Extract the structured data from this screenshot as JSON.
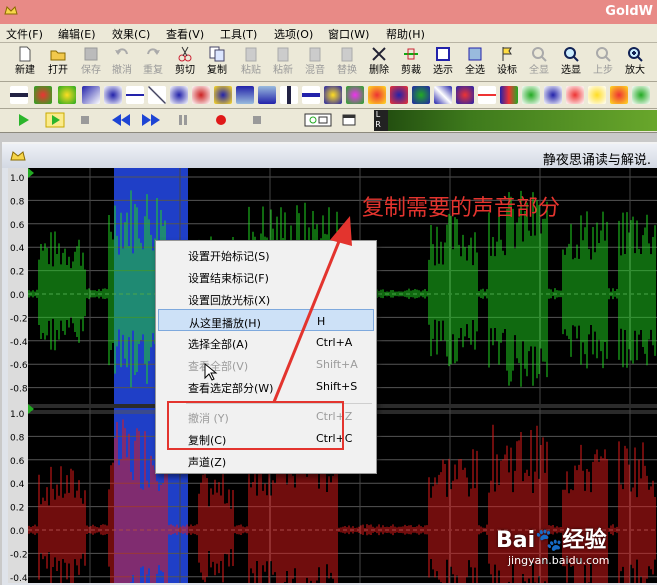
{
  "window": {
    "title": "GoldW"
  },
  "menu": [
    "文件(F)",
    "编辑(E)",
    "效果(C)",
    "查看(V)",
    "工具(T)",
    "选项(O)",
    "窗口(W)",
    "帮助(H)"
  ],
  "toolbar": [
    {
      "label": "新建",
      "icon": "new-file-icon",
      "enabled": true
    },
    {
      "label": "打开",
      "icon": "open-folder-icon",
      "enabled": true
    },
    {
      "label": "保存",
      "icon": "save-icon",
      "enabled": false
    },
    {
      "label": "撤消",
      "icon": "undo-icon",
      "enabled": false
    },
    {
      "label": "重复",
      "icon": "redo-icon",
      "enabled": false
    },
    {
      "label": "剪切",
      "icon": "cut-icon",
      "enabled": true
    },
    {
      "label": "复制",
      "icon": "copy-icon",
      "enabled": true
    },
    {
      "label": "粘贴",
      "icon": "paste-icon",
      "enabled": false
    },
    {
      "label": "粘新",
      "icon": "paste-new-icon",
      "enabled": false
    },
    {
      "label": "混音",
      "icon": "mix-icon",
      "enabled": false
    },
    {
      "label": "替换",
      "icon": "replace-icon",
      "enabled": false
    },
    {
      "label": "删除",
      "icon": "delete-icon",
      "enabled": true
    },
    {
      "label": "剪裁",
      "icon": "trim-icon",
      "enabled": true
    },
    {
      "label": "选示",
      "icon": "select-view-icon",
      "enabled": true
    },
    {
      "label": "全选",
      "icon": "select-all-icon",
      "enabled": true
    },
    {
      "label": "设标",
      "icon": "set-marker-icon",
      "enabled": true
    },
    {
      "label": "全显",
      "icon": "show-all-icon",
      "enabled": false
    },
    {
      "label": "选显",
      "icon": "zoom-selection-icon",
      "enabled": true
    },
    {
      "label": "上步",
      "icon": "previous-zoom-icon",
      "enabled": false
    },
    {
      "label": "放大",
      "icon": "zoom-in-icon",
      "enabled": true
    }
  ],
  "document": {
    "title": "静夜思诵读与解说."
  },
  "axis": {
    "top": [
      "1.0",
      "0.8",
      "0.6",
      "0.4",
      "0.2",
      "0.0",
      "-0.2",
      "-0.4",
      "-0.6",
      "-0.8"
    ],
    "bottom": [
      "1.0",
      "0.8",
      "0.6",
      "0.4",
      "0.2",
      "0.0",
      "-0.2",
      "-0.4"
    ]
  },
  "context_menu": [
    {
      "label": "设置开始标记(S)",
      "shortcut": "",
      "enabled": true,
      "highlighted": false
    },
    {
      "label": "设置结束标记(F)",
      "shortcut": "",
      "enabled": true,
      "highlighted": false
    },
    {
      "label": "设置回放光标(X)",
      "shortcut": "",
      "enabled": true,
      "highlighted": false
    },
    {
      "label": "从这里播放(H)",
      "shortcut": "H",
      "enabled": true,
      "highlighted": true
    },
    {
      "label": "选择全部(A)",
      "shortcut": "Ctrl+A",
      "enabled": true,
      "highlighted": false
    },
    {
      "label": "查看全部(V)",
      "shortcut": "Shift+A",
      "enabled": false,
      "highlighted": false
    },
    {
      "label": "查看选定部分(W)",
      "shortcut": "Shift+S",
      "enabled": true,
      "highlighted": false
    },
    {
      "label": "撤消 (Y)",
      "shortcut": "Ctrl+Z",
      "enabled": false,
      "highlighted": false
    },
    {
      "label": "复制(C)",
      "shortcut": "Ctrl+C",
      "enabled": true,
      "highlighted": false
    },
    {
      "label": "声道(Z)",
      "shortcut": "",
      "enabled": true,
      "highlighted": false
    }
  ],
  "annotation": {
    "text": "复制需要的声音部分",
    "color": "#e3342e"
  },
  "watermark": {
    "main": "Bai🐾经验",
    "sub": "jingyan.baidu.com"
  },
  "colors": {
    "top_channel": "#1fd41f",
    "bottom_channel": "#e01a1a",
    "selection": "#1f3fc7",
    "background": "#000000"
  }
}
